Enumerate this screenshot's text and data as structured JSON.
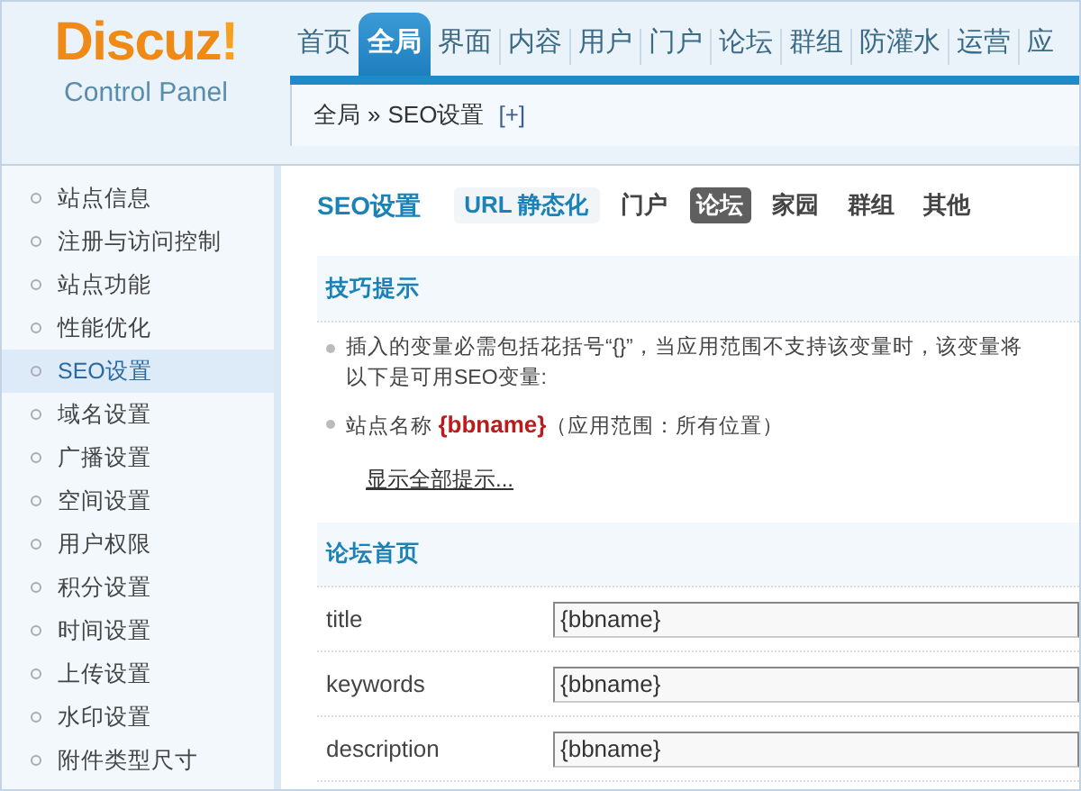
{
  "logo": {
    "name": "Discuz",
    "mark": "!",
    "subtitle": "Control Panel"
  },
  "nav": [
    {
      "label": "首页",
      "selected": false
    },
    {
      "label": "全局",
      "selected": true
    },
    {
      "label": "界面",
      "selected": false
    },
    {
      "label": "内容",
      "selected": false
    },
    {
      "label": "用户",
      "selected": false
    },
    {
      "label": "门户",
      "selected": false
    },
    {
      "label": "论坛",
      "selected": false
    },
    {
      "label": "群组",
      "selected": false
    },
    {
      "label": "防灌水",
      "selected": false
    },
    {
      "label": "运营",
      "selected": false
    },
    {
      "label": "应",
      "selected": false
    }
  ],
  "breadcrumb": {
    "parent": "全局",
    "separator": "»",
    "current": "SEO设置",
    "add": "[+]"
  },
  "sidebar": {
    "items": [
      {
        "label": "站点信息",
        "selected": false
      },
      {
        "label": "注册与访问控制",
        "selected": false
      },
      {
        "label": "站点功能",
        "selected": false
      },
      {
        "label": "性能优化",
        "selected": false
      },
      {
        "label": "SEO设置",
        "selected": true
      },
      {
        "label": "域名设置",
        "selected": false
      },
      {
        "label": "广播设置",
        "selected": false
      },
      {
        "label": "空间设置",
        "selected": false
      },
      {
        "label": "用户权限",
        "selected": false
      },
      {
        "label": "积分设置",
        "selected": false
      },
      {
        "label": "时间设置",
        "selected": false
      },
      {
        "label": "上传设置",
        "selected": false
      },
      {
        "label": "水印设置",
        "selected": false
      },
      {
        "label": "附件类型尺寸",
        "selected": false
      }
    ]
  },
  "page_title": "SEO设置",
  "subtabs": [
    {
      "label": "URL 静态化",
      "kind": "highlight",
      "selected": false
    },
    {
      "label": "门户",
      "kind": "plain",
      "selected": false
    },
    {
      "label": "论坛",
      "kind": "plain",
      "selected": true
    },
    {
      "label": "家园",
      "kind": "plain",
      "selected": false
    },
    {
      "label": "群组",
      "kind": "plain",
      "selected": false
    },
    {
      "label": "其他",
      "kind": "plain",
      "selected": false
    }
  ],
  "tips": {
    "title": "技巧提示",
    "items": [
      {
        "lines": [
          "插入的变量必需包括花括号“{}”，当应用范围不支持该变量时，该变量将",
          "以下是可用SEO变量:"
        ]
      },
      {
        "lines": [
          "站点名称 **{bbname}**（应用范围：所有位置）"
        ]
      }
    ],
    "more": "显示全部提示..."
  },
  "section": {
    "title": "论坛首页",
    "fields": [
      {
        "label": "title",
        "value": "{bbname}"
      },
      {
        "label": "keywords",
        "value": "{bbname}"
      },
      {
        "label": "description",
        "value": "{bbname}"
      }
    ]
  }
}
